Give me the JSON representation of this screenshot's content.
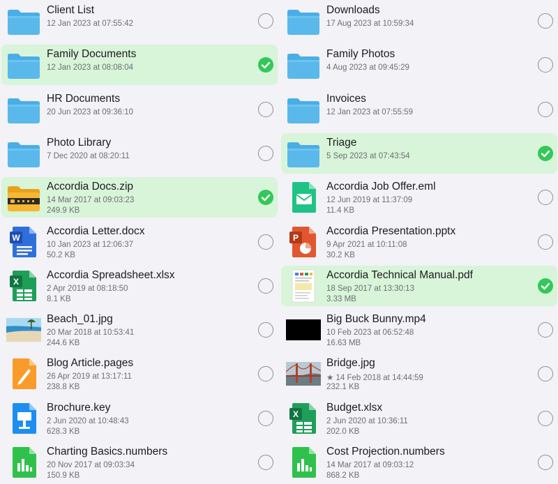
{
  "colors": {
    "selected_bg": "#d8f4d9",
    "check_green": "#34c759",
    "folder_blue": "#5ab8ea",
    "text_primary": "#1c1c1e",
    "text_secondary": "#6e6e73"
  },
  "left_items": [
    {
      "name": "Client List",
      "meta1": "12 Jan 2023 at 07:55:42",
      "meta2": "",
      "icon": "folder-icon",
      "selected": false
    },
    {
      "name": "Family Documents",
      "meta1": "12 Jan 2023 at 08:08:04",
      "meta2": "",
      "icon": "folder-icon",
      "selected": true
    },
    {
      "name": "HR Documents",
      "meta1": "20 Jun 2023 at 09:36:10",
      "meta2": "",
      "icon": "folder-icon",
      "selected": false
    },
    {
      "name": "Photo Library",
      "meta1": "7 Dec 2020 at 08:20:11",
      "meta2": "",
      "icon": "folder-icon",
      "selected": false
    },
    {
      "name": "Accordia Docs.zip",
      "meta1": "14 Mar 2017 at 09:03:23",
      "meta2": "249.9 KB",
      "icon": "zip-archive-icon",
      "selected": true
    },
    {
      "name": "Accordia Letter.docx",
      "meta1": "10 Jan 2023 at 12:06:37",
      "meta2": "50.2 KB",
      "icon": "word-document-icon",
      "selected": false
    },
    {
      "name": "Accordia Spreadsheet.xlsx",
      "meta1": "2 Apr 2019 at 08:18:50",
      "meta2": "8.1 KB",
      "icon": "excel-spreadsheet-icon",
      "selected": false
    },
    {
      "name": "Beach_01.jpg",
      "meta1": "20 Mar 2018 at 10:53:41",
      "meta2": "244.6 KB",
      "icon": "beach-image-thumbnail",
      "selected": false
    },
    {
      "name": "Blog Article.pages",
      "meta1": "26 Apr 2019 at 13:17:11",
      "meta2": "238.8 KB",
      "icon": "pages-document-icon",
      "selected": false
    },
    {
      "name": "Brochure.key",
      "meta1": "2 Jun 2020 at 10:48:43",
      "meta2": "628.3 KB",
      "icon": "keynote-presentation-icon",
      "selected": false
    },
    {
      "name": "Charting Basics.numbers",
      "meta1": "20 Nov 2017 at 09:03:34",
      "meta2": "150.9 KB",
      "icon": "numbers-spreadsheet-icon",
      "selected": false
    }
  ],
  "right_items": [
    {
      "name": "Downloads",
      "meta1": "17 Aug 2023 at 10:59:34",
      "meta2": "",
      "icon": "folder-icon",
      "selected": false
    },
    {
      "name": "Family Photos",
      "meta1": "4 Aug 2023 at 09:45:29",
      "meta2": "",
      "icon": "folder-icon",
      "selected": false
    },
    {
      "name": "Invoices",
      "meta1": "12 Jan 2023 at 07:55:59",
      "meta2": "",
      "icon": "folder-icon",
      "selected": false
    },
    {
      "name": "Triage",
      "meta1": "5 Sep 2023 at 07:43:54",
      "meta2": "",
      "icon": "folder-icon",
      "selected": true
    },
    {
      "name": "Accordia Job Offer.eml",
      "meta1": "12 Jun 2019 at 11:37:09",
      "meta2": "11.4 KB",
      "icon": "email-message-icon",
      "selected": false
    },
    {
      "name": "Accordia Presentation.pptx",
      "meta1": "9 Apr 2021 at 10:11:08",
      "meta2": "30.2 KB",
      "icon": "powerpoint-presentation-icon",
      "selected": false
    },
    {
      "name": "Accordia Technical Manual.pdf",
      "meta1": "18 Sep 2017 at 13:30:13",
      "meta2": "3.33 MB",
      "icon": "pdf-document-thumbnail",
      "selected": true
    },
    {
      "name": "Big Buck Bunny.mp4",
      "meta1": "10 Feb 2023 at 06:52:48",
      "meta2": "16.63 MB",
      "icon": "video-thumbnail",
      "selected": false
    },
    {
      "name": "Bridge.jpg",
      "meta1": "★ 14 Feb 2018 at 14:44:59",
      "meta2": "232.1 KB",
      "icon": "bridge-image-thumbnail",
      "selected": false
    },
    {
      "name": "Budget.xlsx",
      "meta1": "2 Jun 2020 at 10:36:11",
      "meta2": "202.0 KB",
      "icon": "excel-spreadsheet-icon",
      "selected": false
    },
    {
      "name": "Cost Projection.numbers",
      "meta1": "14 Mar 2017 at 09:03:12",
      "meta2": "868.2 KB",
      "icon": "numbers-spreadsheet-icon",
      "selected": false
    }
  ]
}
